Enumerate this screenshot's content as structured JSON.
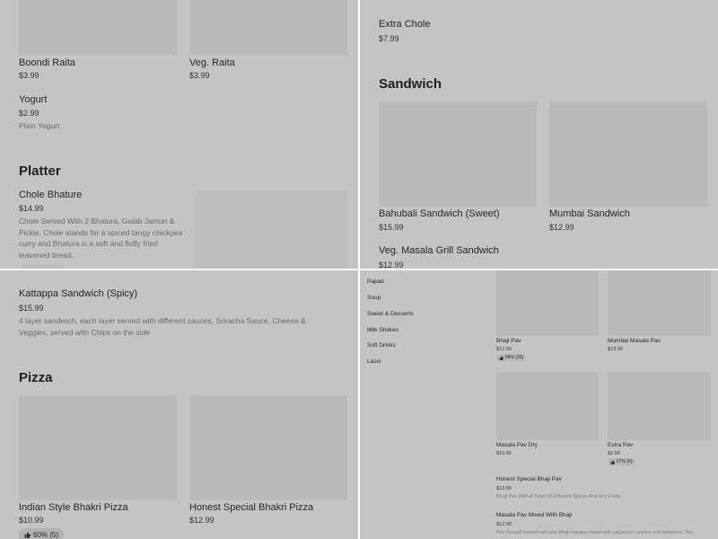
{
  "top_left": {
    "items": [
      {
        "name": "Boondi Raita",
        "price": "$3.99"
      },
      {
        "name": "Veg. Raita",
        "price": "$3.99"
      },
      {
        "name": "Yogurt",
        "price": "$2.99",
        "description": "Plain Yogurt"
      }
    ],
    "section": "Platter",
    "platter_item": {
      "name": "Chole Bhature",
      "price": "$14.99",
      "description": "Chole Served With 2 Bhatura, Gulab Jamun & Pickle. Chole stands for a spiced tangy chickpea curry and Bhatura is a soft and fluffy fried leavened bread."
    }
  },
  "top_right": {
    "extra_item": {
      "name": "Extra Chole",
      "price": "$7.99"
    },
    "section": "Sandwich",
    "items": [
      {
        "name": "Bahubali Sandwich (Sweet)",
        "price": "$15.99"
      },
      {
        "name": "Mumbai Sandwich",
        "price": "$12.99"
      },
      {
        "name": "Veg. Masala Grill Sandwich",
        "price": "$12.99"
      }
    ]
  },
  "bottom_left": {
    "kattappa": {
      "name": "Kattappa Sandwich (Spicy)",
      "price": "$15.99",
      "description": "4 layer sandwich, each layer served with different sauces, Sriracha Sauce, Cheese & Veggies, served with Chips on the side"
    },
    "section": "Pizza",
    "items": [
      {
        "name": "Indian Style Bhakri Pizza",
        "price": "$10.99",
        "rating": "60% (5)"
      },
      {
        "name": "Honest Special Bhakri Pizza",
        "price": "$12.99"
      }
    ]
  },
  "bottom_right": {
    "categories": [
      "Papad",
      "Soup",
      "Sweet & Desserts",
      "Milk Shakes",
      "Soft Drinks",
      "Lassi"
    ],
    "items": [
      {
        "name": "Bhaji Pav",
        "price": "$12.99",
        "rating": "84% (26)"
      },
      {
        "name": "Mumbai Masala Pav",
        "price": "$13.99"
      },
      {
        "name": "Masala Pav Dry",
        "price": "$10.99"
      },
      {
        "name": "Extra Pav",
        "price": "$2.99",
        "rating": "67% (6)"
      }
    ],
    "list_items": [
      {
        "name": "Honest Special Bhaji Pav",
        "price": "$13.99",
        "description": "Bhaji Pav With A Twist Of Different Spices And Dry Fruits"
      },
      {
        "name": "Masala Pav Mixed With Bhaji",
        "price": "$12.99",
        "description": "Pav (bread) tossed with pav bhaji masala mixed with capsicum, onions and tomatoes. You"
      }
    ]
  }
}
